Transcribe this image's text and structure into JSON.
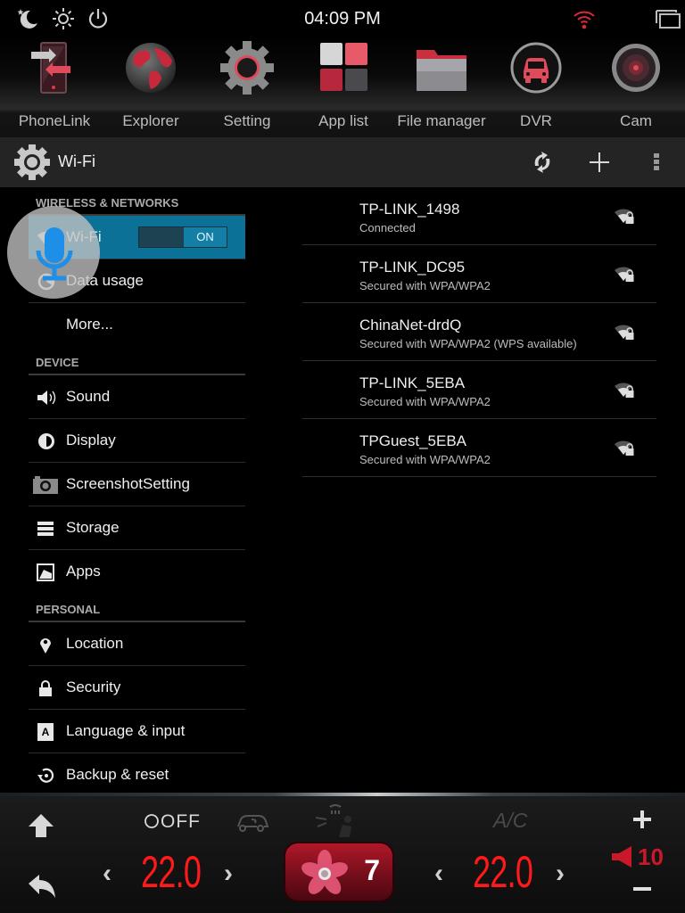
{
  "status_bar": {
    "time": "04:09 PM",
    "icons": [
      "night-mode-icon",
      "brightness-icon",
      "power-icon",
      "wifi-signal-icon",
      "recent-apps-icon"
    ]
  },
  "launcher": {
    "apps": [
      {
        "label": "PhoneLink",
        "icon": "phonelink-icon"
      },
      {
        "label": "Explorer",
        "icon": "globe-icon"
      },
      {
        "label": "Setting",
        "icon": "gear-icon"
      },
      {
        "label": "App list",
        "icon": "app-grid-icon"
      },
      {
        "label": "File manager",
        "icon": "folder-icon"
      },
      {
        "label": "DVR",
        "icon": "car-icon"
      },
      {
        "label": "Cam",
        "icon": "camera-lens-icon"
      }
    ]
  },
  "action_bar": {
    "title": "Wi-Fi",
    "actions": [
      "wps-refresh-icon",
      "add-network-icon",
      "overflow-menu-icon"
    ]
  },
  "settings": {
    "sections": [
      {
        "header": "WIRELESS & NETWORKS",
        "items": [
          {
            "label": "Wi-Fi",
            "icon": "wifi-icon",
            "active": true,
            "toggle": "ON"
          },
          {
            "label": "Data usage",
            "icon": "data-usage-icon"
          },
          {
            "label": "More...",
            "icon": ""
          }
        ]
      },
      {
        "header": "DEVICE",
        "items": [
          {
            "label": "Sound",
            "icon": "speaker-icon"
          },
          {
            "label": "Display",
            "icon": "display-brightness-icon"
          },
          {
            "label": "ScreenshotSetting",
            "icon": "camera-icon"
          },
          {
            "label": "Storage",
            "icon": "storage-icon"
          },
          {
            "label": "Apps",
            "icon": "apps-icon"
          }
        ]
      },
      {
        "header": "PERSONAL",
        "items": [
          {
            "label": "Location",
            "icon": "location-pin-icon"
          },
          {
            "label": "Security",
            "icon": "lock-icon"
          },
          {
            "label": "Language & input",
            "icon": "language-icon"
          },
          {
            "label": "Backup & reset",
            "icon": "backup-icon"
          }
        ]
      }
    ]
  },
  "wifi_networks": [
    {
      "name": "TP-LINK_1498",
      "status": "Connected"
    },
    {
      "name": "TP-LINK_DC95",
      "status": "Secured with WPA/WPA2"
    },
    {
      "name": "ChinaNet-drdQ",
      "status": "Secured with WPA/WPA2 (WPS available)"
    },
    {
      "name": "TP-LINK_5EBA",
      "status": "Secured with WPA/WPA2"
    },
    {
      "name": "TPGuest_5EBA",
      "status": "Secured with WPA/WPA2"
    }
  ],
  "climate": {
    "power_label": "OFF",
    "ac_label": "A/C",
    "left_temp": "22.0",
    "right_temp": "22.0",
    "fan_speed": "7",
    "volume": "10",
    "colors": {
      "temp": "#ff1a1a",
      "accent": "#b01829",
      "wifi_active": "#0c7196"
    }
  }
}
